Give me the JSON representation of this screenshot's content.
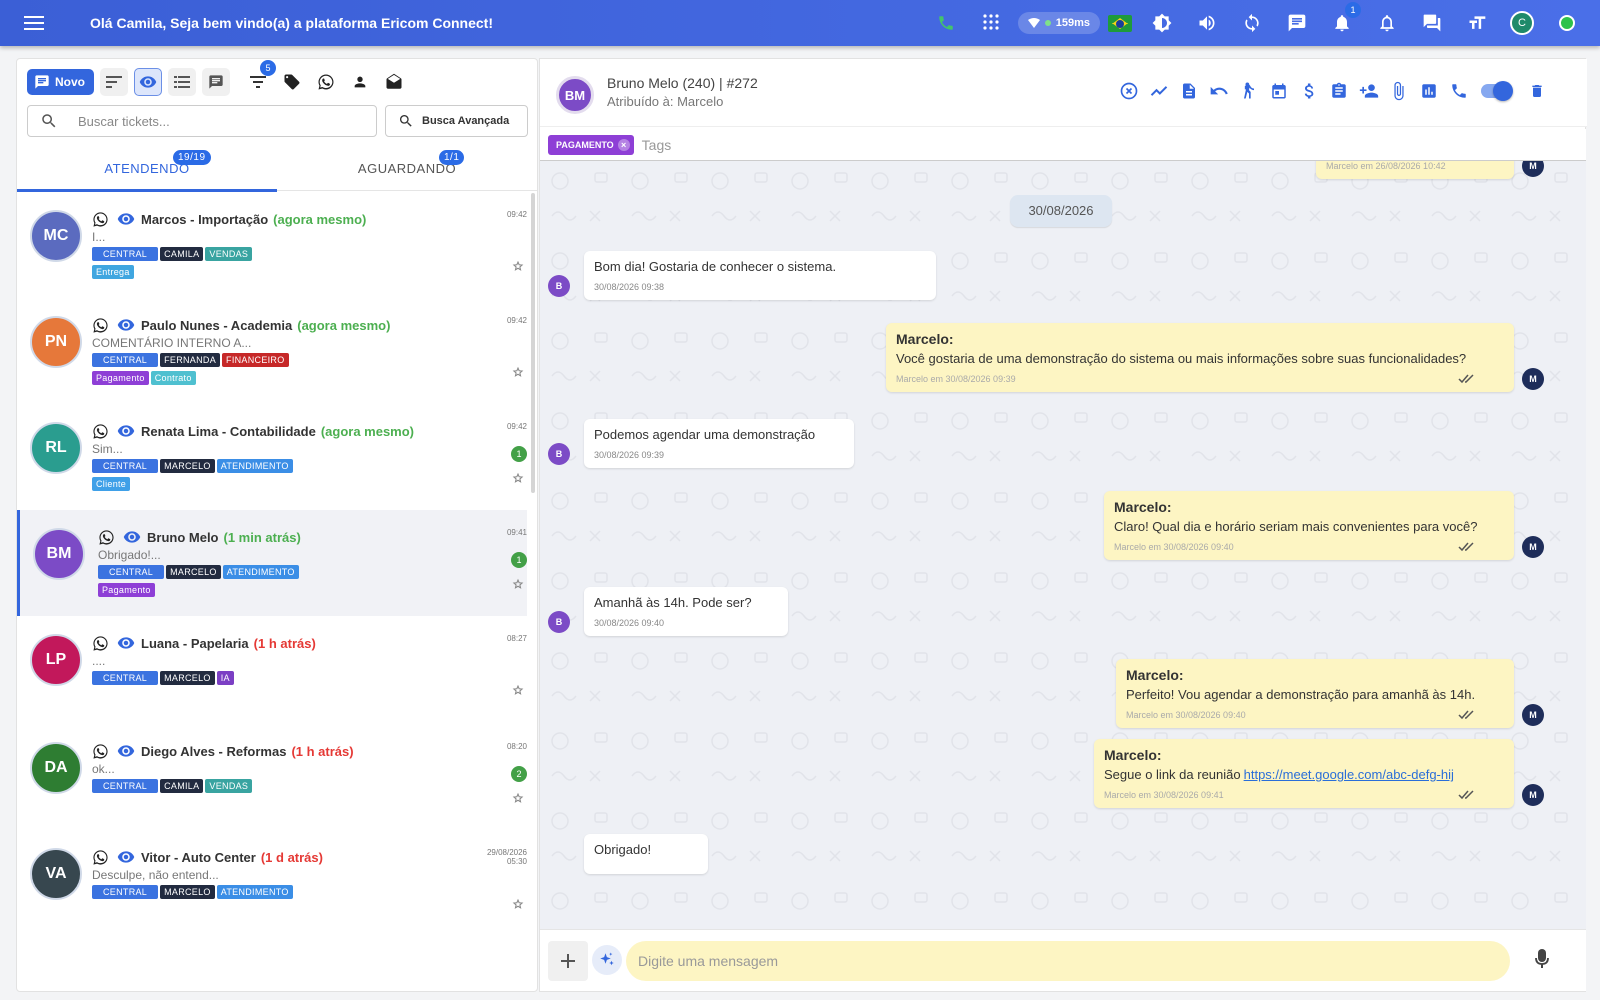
{
  "topbar": {
    "welcome": "Olá Camila, Seja bem vindo(a) a plataforma Ericom Connect!",
    "ping": "159ms",
    "notifications_count": "1",
    "user_initial": "C"
  },
  "toolbar": {
    "novo_label": "Novo",
    "filter_badge": "5"
  },
  "search": {
    "placeholder": "Buscar tickets...",
    "advanced_label": "Busca Avançada"
  },
  "tabs": [
    {
      "label": "ATENDENDO",
      "badge": "19/19"
    },
    {
      "label": "AGUARDANDO",
      "badge": "1/1"
    }
  ],
  "tickets": [
    {
      "initials": "MC",
      "color": "#5b6bbf",
      "name": "Marcos - Importação",
      "time_ago": "(agora mesmo)",
      "preview": "I...",
      "hour": "09:42",
      "count": "",
      "tags": [
        "CENTRAL",
        "CAMILA",
        "VENDAS"
      ],
      "tags2": [
        "Entrega"
      ]
    },
    {
      "initials": "PN",
      "color": "#e6783a",
      "name": "Paulo Nunes - Academia",
      "time_ago": "(agora mesmo)",
      "preview": "COMENTÁRIO INTERNO A...",
      "hour": "09:42",
      "count": "",
      "tags": [
        "CENTRAL",
        "FERNANDA",
        "FINANCEIRO"
      ],
      "tags2": [
        "Pagamento",
        "Contrato"
      ]
    },
    {
      "initials": "RL",
      "color": "#2a9d8f",
      "name": "Renata Lima - Contabilidade",
      "time_ago": "(agora mesmo)",
      "preview": "Sim...",
      "hour": "09:42",
      "count": "1",
      "tags": [
        "CENTRAL",
        "MARCELO",
        "ATENDIMENTO"
      ],
      "tags2": [
        "Cliente"
      ]
    },
    {
      "initials": "BM",
      "color": "#7c4bc6",
      "name": "Bruno Melo",
      "time_ago": "(1 min atrás)",
      "preview": "Obrigado!...",
      "hour": "09:41",
      "count": "1",
      "tags": [
        "CENTRAL",
        "MARCELO",
        "ATENDIMENTO"
      ],
      "tags2": [
        "Pagamento"
      ]
    },
    {
      "initials": "LP",
      "color": "#c2185b",
      "name": "Luana - Papelaria",
      "time_ago": "(1 h atrás)",
      "preview": "....",
      "hour": "08:27",
      "count": "",
      "tags": [
        "CENTRAL",
        "MARCELO",
        "IA"
      ],
      "tags2": []
    },
    {
      "initials": "DA",
      "color": "#2e7d32",
      "name": "Diego Alves - Reformas",
      "time_ago": "(1 h atrás)",
      "preview": "ok...",
      "hour": "08:20",
      "count": "2",
      "tags": [
        "CENTRAL",
        "CAMILA",
        "VENDAS"
      ],
      "tags2": []
    },
    {
      "initials": "VA",
      "color": "#37474f",
      "name": "Vitor - Auto Center",
      "time_ago": "(1 d atrás)",
      "preview": "Desculpe, não entend...",
      "hour": "29/08/2026 05:30",
      "count": "",
      "tags": [
        "CENTRAL",
        "MARCELO",
        "ATENDIMENTO"
      ],
      "tags2": []
    }
  ],
  "chat": {
    "avatar": "BM",
    "title": "Bruno Melo (240) | #272",
    "assigned": "Atribuído à: Marcelo",
    "tag_chip": "PAGAMENTO",
    "tags_placeholder": "Tags",
    "prev_meta": "Marcelo em 26/08/2026 10:42",
    "date_divider": "30/08/2026",
    "messages": [
      {
        "dir": "in",
        "text": "Bom dia! Gostaria de conhecer o sistema.",
        "meta": "30/08/2026 09:38",
        "avatar": "B"
      },
      {
        "dir": "out",
        "author": "Marcelo:",
        "text": "Você gostaria de uma demonstração do sistema ou mais informações sobre suas funcionalidades?",
        "meta": "Marcelo em 30/08/2026 09:39",
        "avatar": "M"
      },
      {
        "dir": "in",
        "text": "Podemos agendar uma demonstração",
        "meta": "30/08/2026 09:39",
        "avatar": "B"
      },
      {
        "dir": "out",
        "author": "Marcelo:",
        "text": "Claro! Qual dia e horário seriam mais convenientes para você?",
        "meta": "Marcelo em 30/08/2026 09:40",
        "avatar": "M"
      },
      {
        "dir": "in",
        "text": "Amanhã às 14h. Pode ser?",
        "meta": "30/08/2026 09:40",
        "avatar": "B"
      },
      {
        "dir": "out",
        "author": "Marcelo:",
        "text": "Perfeito! Vou agendar a demonstração para amanhã às 14h.",
        "meta": "Marcelo em 30/08/2026 09:40",
        "avatar": "M"
      },
      {
        "dir": "out",
        "author": "Marcelo:",
        "text": "Segue o link da reunião",
        "link": "https://meet.google.com/abc-defg-hij",
        "meta": "Marcelo em 30/08/2026 09:41",
        "avatar": "M"
      },
      {
        "dir": "in",
        "text": "Obrigado!",
        "meta": "",
        "avatar": ""
      }
    ],
    "composer_placeholder": "Digite uma mensagem"
  },
  "colors": {
    "primary": "#3366dd",
    "outgoing_bubble": "#fdf5c3",
    "online": "#2ec24a"
  }
}
